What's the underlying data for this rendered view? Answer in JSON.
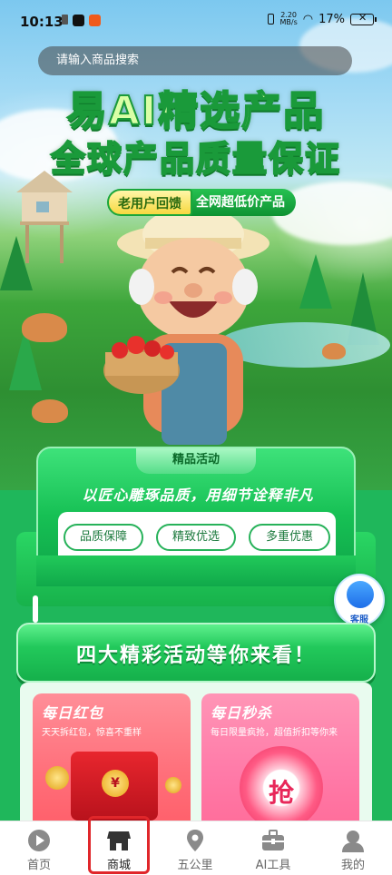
{
  "status_bar": {
    "time": "10:13",
    "net_speed_value": "2.20",
    "net_speed_unit": "MB/s",
    "battery_percent": "17%"
  },
  "search": {
    "placeholder": "请输入商品搜索"
  },
  "hero": {
    "headline_line1": "易AI精选产品",
    "headline_line2": "全球产品质量保证",
    "tag_yellow": "老用户回馈",
    "tag_green": "全网超低价产品"
  },
  "activity": {
    "tab_label": "精品活动",
    "subtitle": "以匠心雕琢品质，用细节诠释非凡",
    "pills": [
      "品质保障",
      "精致优选",
      "多重优惠"
    ]
  },
  "customer_service": {
    "label": "客服"
  },
  "banner": {
    "text": "四大精彩活动等你来看！"
  },
  "promos": [
    {
      "title": "每日红包",
      "subtitle": "天天拆红包，惊喜不重样",
      "badge": "¥"
    },
    {
      "title": "每日秒杀",
      "subtitle": "每日限量疯抢，超值折扣等你来",
      "badge": "抢"
    }
  ],
  "bottom_nav": [
    {
      "label": "首页",
      "icon": "play-icon"
    },
    {
      "label": "商城",
      "icon": "store-icon",
      "active": true
    },
    {
      "label": "五公里",
      "icon": "location-pin-icon"
    },
    {
      "label": "AI工具",
      "icon": "toolbox-icon"
    },
    {
      "label": "我的",
      "icon": "profile-icon"
    }
  ],
  "colors": {
    "brand_green": "#1fb75b",
    "active_highlight": "#e0262a"
  }
}
